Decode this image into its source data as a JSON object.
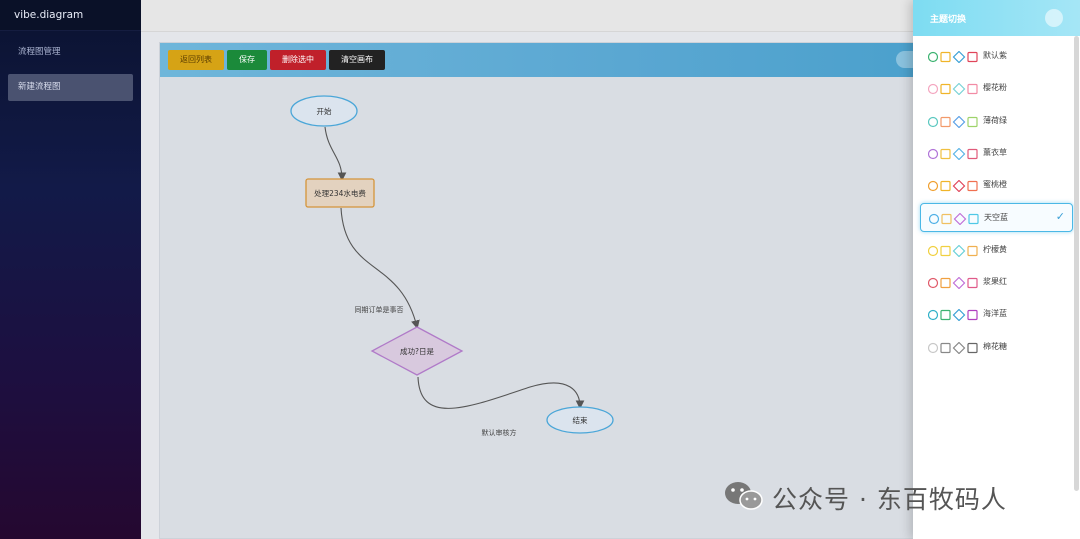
{
  "app": {
    "brand": "vibe.diagram"
  },
  "sidebar": {
    "items": [
      {
        "label": "流程图管理",
        "active": false
      },
      {
        "label": "新建流程图",
        "active": true
      }
    ]
  },
  "toolbar": {
    "back_label": "返回列表",
    "save_label": "保存",
    "delete_label": "删除选中",
    "clear_label": "清空画布"
  },
  "flow": {
    "nodes": {
      "start": "开始",
      "process": "处理234水电费",
      "decision": "成功?日是",
      "end": "结束"
    },
    "edges": {
      "process_to_decision": "同期订单是事否",
      "decision_to_end": "默认审核方"
    }
  },
  "theme_panel": {
    "title": "主题切换",
    "themes": [
      {
        "name": "默认紫",
        "colors": [
          "#3cb371",
          "#f0b429",
          "#3aa0d6",
          "#e0455a"
        ],
        "selected": false
      },
      {
        "name": "樱花粉",
        "colors": [
          "#f4a6c0",
          "#f0b429",
          "#79d3d6",
          "#f28ba4"
        ],
        "selected": false
      },
      {
        "name": "薄荷绿",
        "colors": [
          "#5bc8c0",
          "#f29a6a",
          "#5aa0e6",
          "#9ed36a"
        ],
        "selected": false
      },
      {
        "name": "薰衣草",
        "colors": [
          "#b074d8",
          "#f0c040",
          "#5ab4e6",
          "#e05a7a"
        ],
        "selected": false
      },
      {
        "name": "蜜桃橙",
        "colors": [
          "#f0a030",
          "#f0b429",
          "#e0455a",
          "#f07050"
        ],
        "selected": false
      },
      {
        "name": "天空蓝",
        "colors": [
          "#4fb0e6",
          "#f0c060",
          "#c070d8",
          "#4fc8e6"
        ],
        "selected": true
      },
      {
        "name": "柠檬黄",
        "colors": [
          "#f0d040",
          "#f0d040",
          "#6ad0d8",
          "#f0b050"
        ],
        "selected": false
      },
      {
        "name": "浆果红",
        "colors": [
          "#e05a6a",
          "#f0a040",
          "#c070d8",
          "#e05a8a"
        ],
        "selected": false
      },
      {
        "name": "海洋蓝",
        "colors": [
          "#30b0c8",
          "#3cb371",
          "#3aa0d6",
          "#b040c0"
        ],
        "selected": false
      },
      {
        "name": "棉花糖",
        "colors": [
          "#c8c8c8",
          "#888888",
          "#888888",
          "#666666"
        ],
        "selected": false
      }
    ]
  },
  "watermark": {
    "text": "公众号 · 东百牧码人"
  }
}
